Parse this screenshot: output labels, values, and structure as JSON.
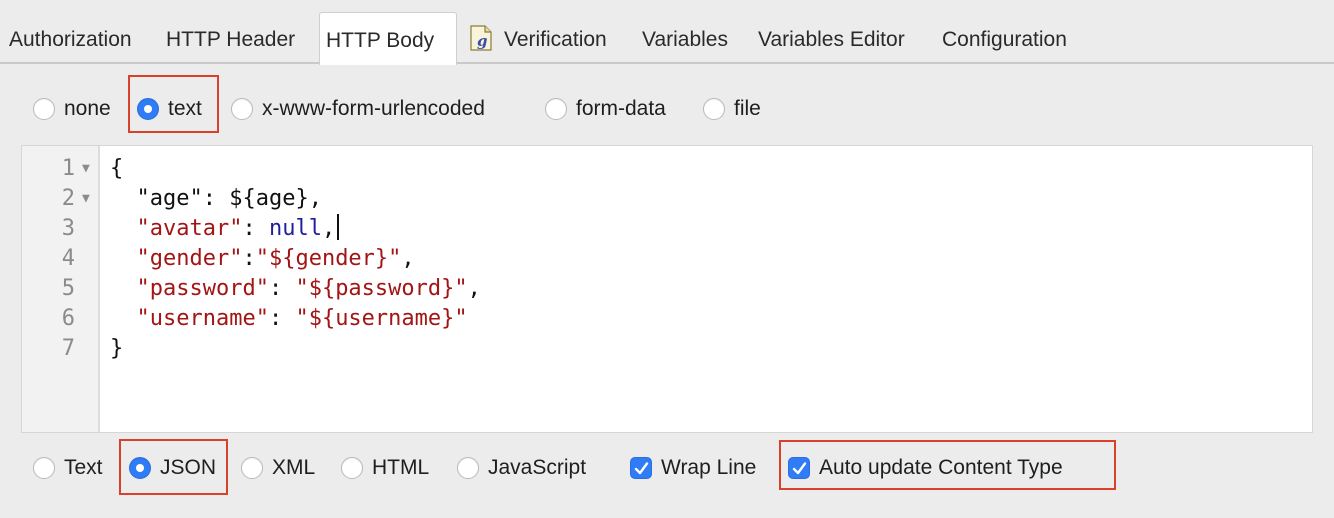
{
  "tabs": {
    "authorization": "Authorization",
    "http_header": "HTTP Header",
    "http_body": "HTTP Body",
    "verification_icon": "groovy-script-icon",
    "verification": "Verification",
    "variables": "Variables",
    "variables_editor": "Variables Editor",
    "configuration": "Configuration",
    "active": "HTTP Body"
  },
  "body_type": {
    "options": [
      "none",
      "text",
      "x-www-form-urlencoded",
      "form-data",
      "file"
    ],
    "selected": "text"
  },
  "editor": {
    "line_numbers": [
      "1",
      "2",
      "3",
      "4",
      "5",
      "6",
      "7"
    ],
    "lines": {
      "l1": "{",
      "l2_key": "\"age\"",
      "l2_sep": ": ",
      "l2_val": "${age}",
      "l2_end": ",",
      "l3_key": "\"avatar\"",
      "l3_sep": ": ",
      "l3_val": "null",
      "l3_end": ",",
      "l4_key": "\"gender\"",
      "l4_sep": ":",
      "l4_val": "\"${gender}\"",
      "l4_end": ",",
      "l5_key": "\"password\"",
      "l5_sep": ": ",
      "l5_val": "\"${password}\"",
      "l5_end": ",",
      "l6_key": "\"username\"",
      "l6_sep": ": ",
      "l6_val": "\"${username}\"",
      "l7": "}"
    }
  },
  "format": {
    "options": [
      "Text",
      "JSON",
      "XML",
      "HTML",
      "JavaScript"
    ],
    "selected": "JSON"
  },
  "checkboxes": {
    "wrap_line": "Wrap Line",
    "wrap_line_checked": true,
    "auto_update": "Auto update Content Type",
    "auto_update_checked": true
  },
  "colors": {
    "accent": "#2f7cf6",
    "highlight": "#d9412b",
    "string": "#a31515",
    "keyword": "#1f1f9e"
  }
}
